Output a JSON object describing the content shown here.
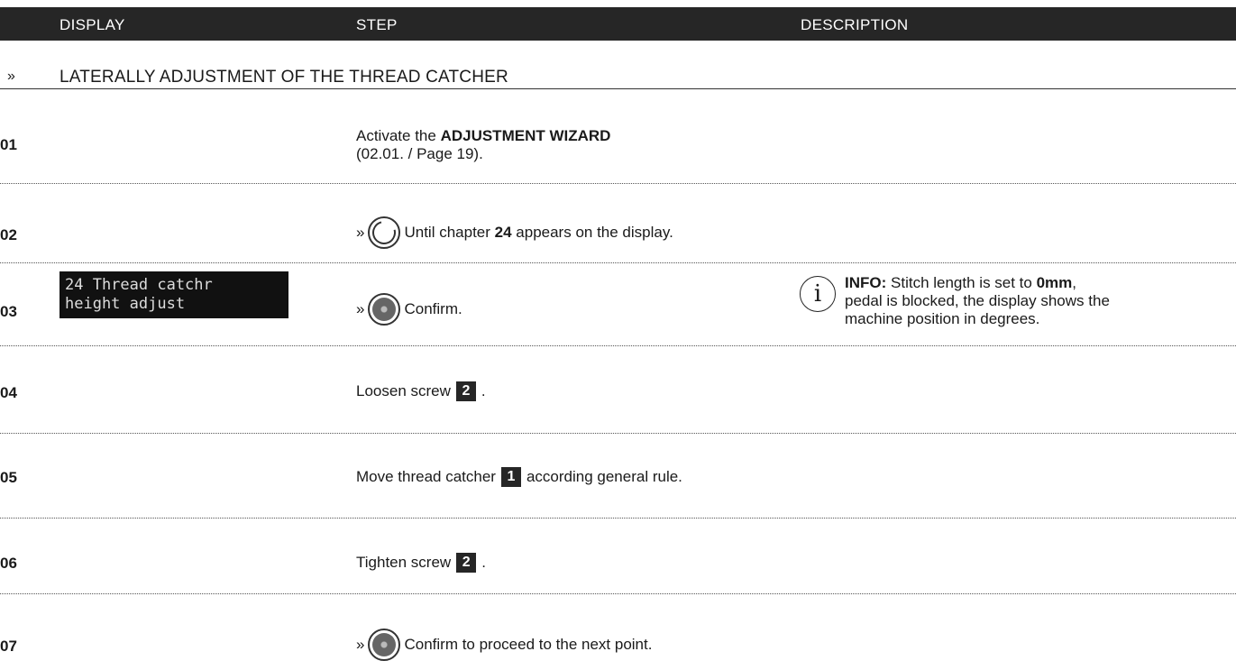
{
  "header": {
    "display": "DISPLAY",
    "step": "STEP",
    "description": "DESCRIPTION"
  },
  "section": {
    "marker": "»",
    "title": "LATERALLY ADJUSTMENT OF THE THREAD CATCHER"
  },
  "rows": [
    {
      "num": "01",
      "text_a": "Activate the ",
      "bold": "ADJUSTMENT WIZARD",
      "text_b": "(02.01. / Page 19)."
    },
    {
      "num": "02",
      "marker": "»",
      "icon": "rotary-knob-icon",
      "text_a": "Until chapter ",
      "bold": "24",
      "text_b": " appears on the display."
    },
    {
      "num": "03",
      "marker": "»",
      "icon": "push-knob-icon",
      "text": "Confirm.",
      "lcd_line1": "24 Thread catchr",
      "lcd_line2": "height adjust"
    },
    {
      "num": "04",
      "text_a": "Loosen screw ",
      "ref": "2",
      "text_b": " ."
    },
    {
      "num": "05",
      "text_a": "Move thread catcher ",
      "ref": "1",
      "text_b": " according general rule."
    },
    {
      "num": "06",
      "text_a": "Tighten screw ",
      "ref": "2",
      "text_b": " ."
    },
    {
      "num": "07",
      "marker": "»",
      "icon": "push-knob-icon",
      "text": "Confirm to proceed to the next point."
    }
  ],
  "info": {
    "label": "INFO:",
    "text_a": " Stitch length is set to ",
    "bold": "0mm",
    "text_b": ",",
    "line2": "pedal is blocked, the display shows the",
    "line3": "machine position in degrees."
  }
}
